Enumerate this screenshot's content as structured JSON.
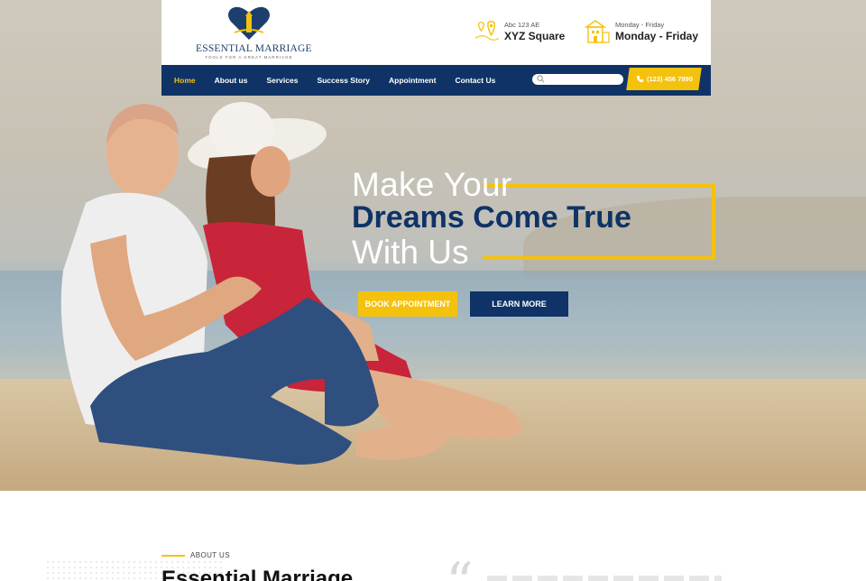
{
  "brand": {
    "name": "ESSENTIAL MARRIAGE",
    "tagline": "TOOLS FOR A GREAT MARRIAGE",
    "icon": "lighthouse-heart-logo"
  },
  "header": {
    "address_small": "Abc 123 AE",
    "address_big": "XYZ Square",
    "hours_small": "Monday - Friday",
    "hours_big": "Monday - Friday",
    "address_icon": "map-pin-icon",
    "hours_icon": "building-icon"
  },
  "nav": {
    "items": [
      {
        "label": "Home",
        "active": true
      },
      {
        "label": "About us"
      },
      {
        "label": "Services"
      },
      {
        "label": "Success Story"
      },
      {
        "label": "Appointment"
      },
      {
        "label": "Contact Us"
      }
    ],
    "search_placeholder": "",
    "phone": "(123) 456 7890"
  },
  "hero": {
    "line1": "Make Your",
    "line2": "Dreams Come True",
    "line3": "With Us",
    "book_label": "BOOK APPOINTMENT",
    "learn_label": "LEARN MORE"
  },
  "about": {
    "eyebrow": "ABOUT US",
    "title": "Essential Marriage"
  },
  "colors": {
    "accent": "#f4c20d",
    "primary": "#0f3366"
  }
}
